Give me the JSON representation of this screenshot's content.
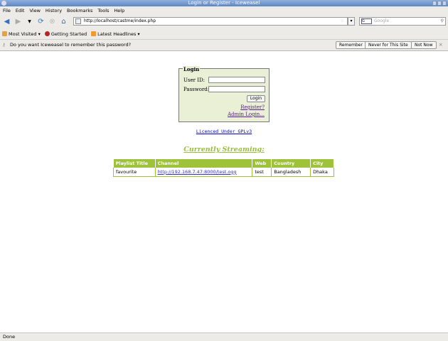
{
  "window": {
    "title": "Login or Register - Iceweasel"
  },
  "menu": [
    "File",
    "Edit",
    "View",
    "History",
    "Bookmarks",
    "Tools",
    "Help"
  ],
  "nav": {
    "url": "http://localhost/castme/index.php",
    "search_placeholder": "Google",
    "search_engine": "G"
  },
  "bookmarks": [
    "Most Visited",
    "Getting Started",
    "Latest Headlines"
  ],
  "notification": {
    "text": "Do you want Iceweasel to remember this password?",
    "remember": "Remember",
    "never": "Never for This Site",
    "not_now": "Not Now",
    "close": "✕"
  },
  "login": {
    "legend": "Login",
    "user_label": "User ID:",
    "password_label": "Password:",
    "user_value": "",
    "password_value": "",
    "button": "Login",
    "register": "Register?",
    "admin": "Admin Login..."
  },
  "license": "Licenced Under GPLv3",
  "streaming": {
    "heading": "Currently Streaming:",
    "headers": [
      "Playlist Title",
      "Channel",
      "Web",
      "Country",
      "City"
    ],
    "rows": [
      [
        "favourite",
        "http://192.168.7.47:8000/test.ogg",
        "test",
        "Bangladesh",
        "Dhaka"
      ]
    ]
  },
  "status": "Done"
}
